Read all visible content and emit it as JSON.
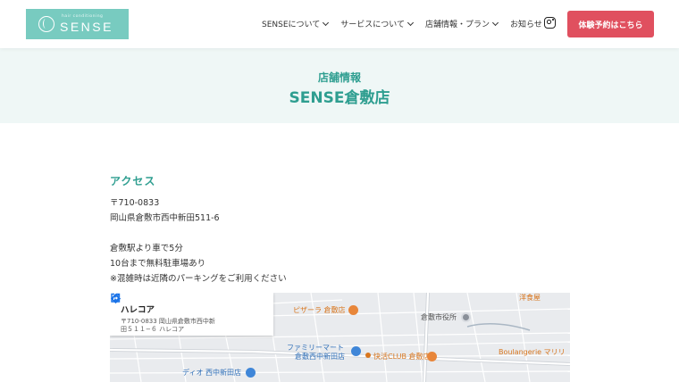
{
  "header": {
    "logo": {
      "sub": "hair conditioning",
      "main": "SENSE"
    },
    "nav": [
      {
        "label": "SENSEについて",
        "has_dropdown": true
      },
      {
        "label": "サービスについて",
        "has_dropdown": true
      },
      {
        "label": "店舗情報・プラン",
        "has_dropdown": true
      },
      {
        "label": "お知らせ",
        "has_dropdown": false
      }
    ],
    "social_icon": "instagram-icon",
    "cta_label": "体験予約はこちら"
  },
  "hero": {
    "kicker": "店舗情報",
    "title": "SENSE倉敷店"
  },
  "access": {
    "heading": "アクセス",
    "postal": "〒710-0833",
    "address": "岡山県倉敷市西中新田511-6",
    "station": "倉敷駅より車で5分",
    "parking": "10台まで無料駐車場あり",
    "note": "※混雑時は近隣のパーキングをご利用ください"
  },
  "map": {
    "card": {
      "name": "ハレコア",
      "address": "〒710-0833 岡山県倉敷市西中新田５１１−６ ハレコア"
    },
    "pois": {
      "pizza": "ピザーラ 倉敷店",
      "city_hall": "倉敷市役所",
      "familymart_1": "ファミリーマート",
      "familymart_2": "倉敷西中新田店",
      "kaikatsu": "快活CLUB 倉敷店",
      "boulangerie": "Boulangerie マリリ",
      "dio": "ディオ 西中新田店",
      "top_right": "洋食屋"
    },
    "colors": {
      "orange": "#d8761e",
      "blue": "#2f6fb8",
      "teal": "#2e9e90",
      "cta": "#e0505f"
    }
  }
}
